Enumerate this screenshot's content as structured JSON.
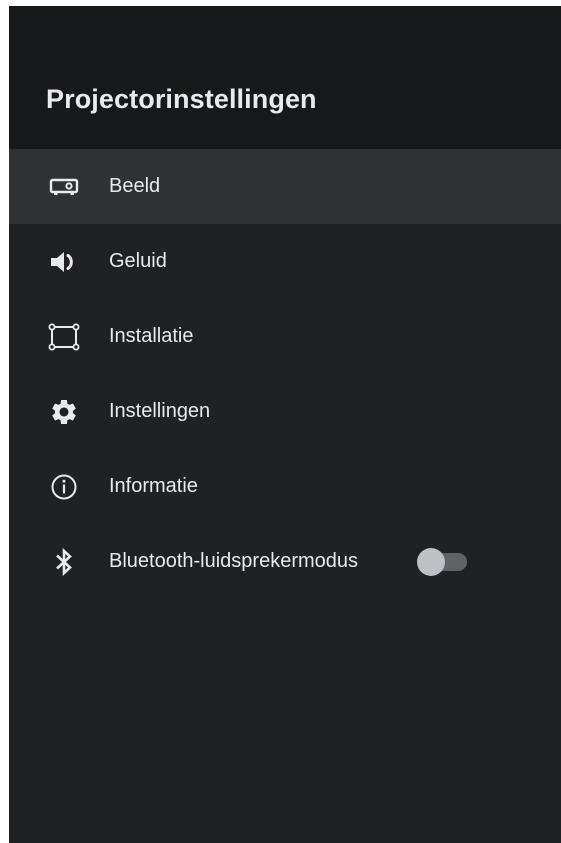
{
  "header": {
    "title": "Projectorinstellingen"
  },
  "menu": {
    "items": [
      {
        "label": "Beeld",
        "icon": "projector-icon",
        "selected": true
      },
      {
        "label": "Geluid",
        "icon": "speaker-icon",
        "selected": false
      },
      {
        "label": "Installatie",
        "icon": "installation-frame-icon",
        "selected": false
      },
      {
        "label": "Instellingen",
        "icon": "gear-icon",
        "selected": false
      },
      {
        "label": "Informatie",
        "icon": "info-icon",
        "selected": false
      },
      {
        "label": "Bluetooth-luidsprekermodus",
        "icon": "bluetooth-icon",
        "selected": false,
        "toggle": false
      }
    ]
  },
  "colors": {
    "background": "#202124",
    "header_background": "#17181a",
    "selected_row": "#303134",
    "text": "#e8eaed",
    "toggle_track_off": "#5f6368",
    "toggle_thumb_off": "#bdc1c6"
  }
}
